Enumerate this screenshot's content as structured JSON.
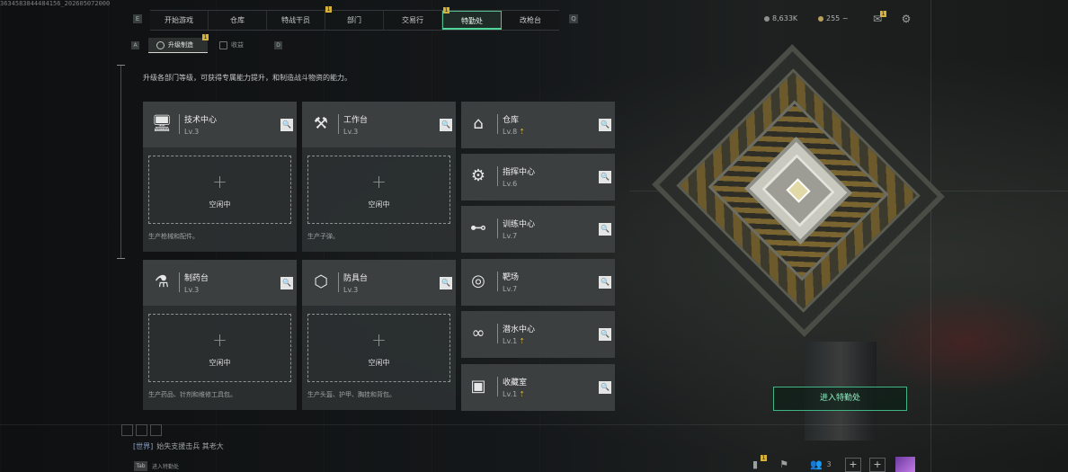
{
  "build_tag": "3634583844484156_202605072000",
  "nav": {
    "left_key": "E",
    "right_key": "Q",
    "tabs": [
      {
        "label": "开始游戏",
        "badge": ""
      },
      {
        "label": "仓库",
        "badge": ""
      },
      {
        "label": "特战干员",
        "badge": ""
      },
      {
        "label": "部门",
        "badge": "1"
      },
      {
        "label": "交易行",
        "badge": ""
      },
      {
        "label": "特勤处",
        "badge": "1"
      },
      {
        "label": "改枪台",
        "badge": ""
      }
    ],
    "active_tab": "特勤处"
  },
  "resources": {
    "currency": "8,633K",
    "tickets": "255",
    "tickets_arrow": "~"
  },
  "top_right": {
    "mail_badge": "1",
    "mail_icon": "mail-icon",
    "settings_icon": "gear-icon"
  },
  "subtabs": {
    "left_key": "A",
    "right_key": "D",
    "items": [
      {
        "label": "升级制造",
        "badge": "1"
      },
      {
        "label": "收益",
        "badge": ""
      }
    ]
  },
  "subtitle": "升级各部门等级，可获得专属能力提升，和制造战斗物资的能力。",
  "slot_label": "空闲中",
  "workbenches": [
    {
      "name": "技术中心",
      "level": "Lv.3",
      "desc": "生产枪械和配件。",
      "icon": "monitor-icon",
      "glyph": "🖥"
    },
    {
      "name": "工作台",
      "level": "Lv.3",
      "desc": "生产子弹。",
      "icon": "tools-icon",
      "glyph": "⚒"
    },
    {
      "name": "制药台",
      "level": "Lv.3",
      "desc": "生产药品、针剂和维修工具包。",
      "icon": "microscope-icon",
      "glyph": "⚗"
    },
    {
      "name": "防具台",
      "level": "Lv.3",
      "desc": "生产头盔、护甲、胸挂和背包。",
      "icon": "armor-icon",
      "glyph": "⬡"
    }
  ],
  "facilities": [
    {
      "name": "仓库",
      "level": "Lv.8",
      "upgrade": true,
      "icon": "storage-icon",
      "glyph": "⌂"
    },
    {
      "name": "指挥中心",
      "level": "Lv.6",
      "upgrade": false,
      "icon": "chip-icon",
      "glyph": "⚙"
    },
    {
      "name": "训练中心",
      "level": "Lv.7",
      "upgrade": false,
      "icon": "dumbbell-icon",
      "glyph": "⊷"
    },
    {
      "name": "靶场",
      "level": "Lv.7",
      "upgrade": false,
      "icon": "target-icon",
      "glyph": "◎"
    },
    {
      "name": "潜水中心",
      "level": "Lv.1",
      "upgrade": true,
      "icon": "goggles-icon",
      "glyph": "∞"
    },
    {
      "name": "收藏室",
      "level": "Lv.1",
      "upgrade": true,
      "icon": "trophy-icon",
      "glyph": "▣"
    }
  ],
  "enter_button": "进入特勤处",
  "chat": {
    "channel": "[世界]",
    "message": "始失支援击兵 其老大",
    "key": "Tab",
    "hint": "进入特勤处"
  },
  "bottom_right": {
    "badge": "1",
    "friends_count": "3",
    "add_label": "+"
  },
  "colors": {
    "accent": "#4fd699",
    "badge": "#d7b23a",
    "card": "#3b3f40"
  }
}
